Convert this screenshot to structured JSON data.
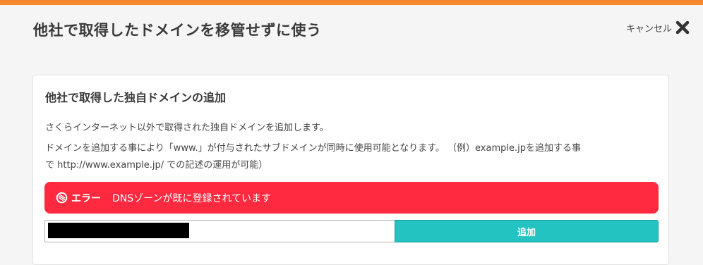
{
  "header": {
    "title": "他社で取得したドメインを移管せずに使う",
    "cancel_label": "キャンセル",
    "close_icon": "close-icon"
  },
  "colors": {
    "accent_bar": "#f7882f",
    "error": "#ff2a3f",
    "add_button": "#22c3c1"
  },
  "section": {
    "title": "他社で取得した独自ドメインの追加",
    "desc1": "さくらインターネット以外で取得された独自ドメインを追加します。",
    "desc2": "ドメインを追加する事により「www.」が付与されたサブドメインが同時に使用可能となります。 （例）example.jpを追加する事",
    "desc3": "で http://www.example.jp/ での記述の運用が可能）"
  },
  "alert": {
    "icon": "ban-icon",
    "label": "エラー",
    "message": "DNSゾーンが既に登録されています"
  },
  "form": {
    "domain_value": "",
    "add_label": "追加"
  }
}
